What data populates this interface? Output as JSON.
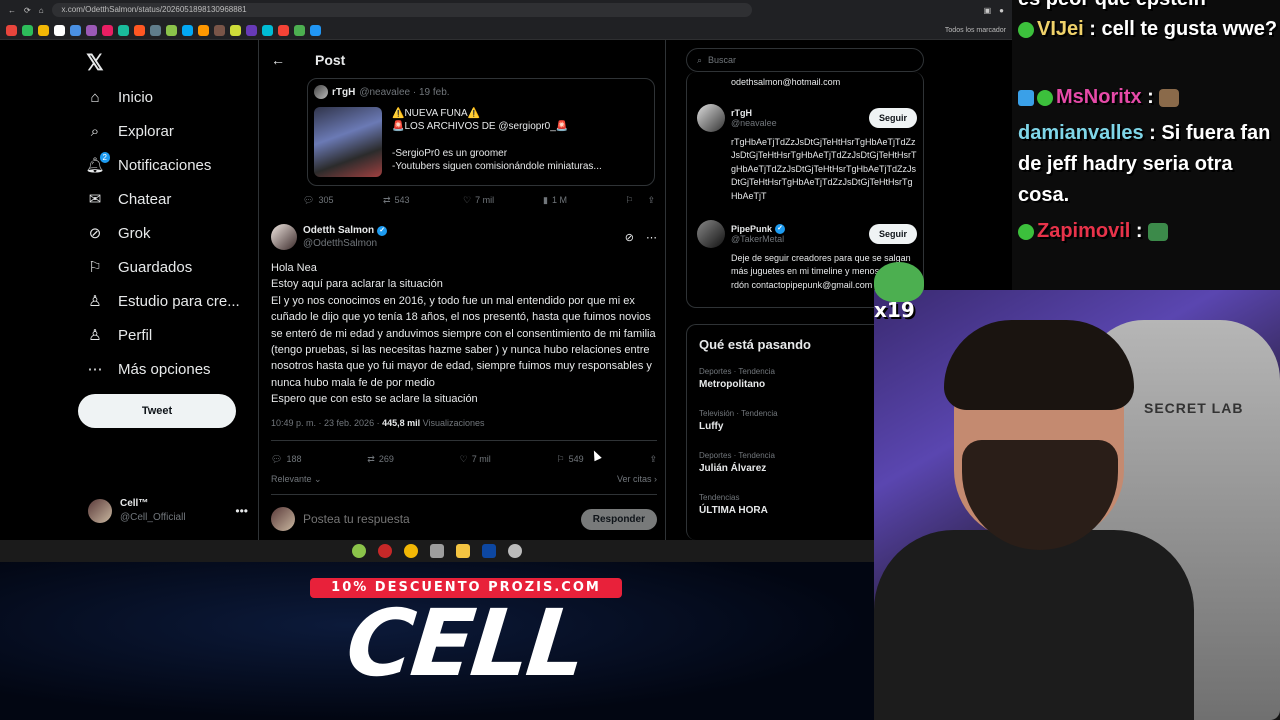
{
  "browser": {
    "url": "x.com/OdetthSalmon/status/2026051898130968881",
    "bookmarks_label": "Todos los marcador"
  },
  "nav": {
    "items": [
      {
        "label": "Inicio",
        "icon": "home-icon"
      },
      {
        "label": "Explorar",
        "icon": "search-icon"
      },
      {
        "label": "Notificaciones",
        "icon": "bell-icon",
        "badge": "2"
      },
      {
        "label": "Chatear",
        "icon": "mail-icon"
      },
      {
        "label": "Grok",
        "icon": "grok-icon"
      },
      {
        "label": "Guardados",
        "icon": "bookmark-icon"
      },
      {
        "label": "Estudio para cre...",
        "icon": "studio-icon"
      },
      {
        "label": "Perfil",
        "icon": "person-icon"
      },
      {
        "label": "Más opciones",
        "icon": "more-circle-icon"
      }
    ],
    "tweet_button": "Tweet",
    "account": {
      "name": "Cell™",
      "handle": "@Cell_Officiall"
    }
  },
  "post": {
    "header_title": "Post",
    "quoted": {
      "name": "rTgH",
      "handle": "@neavalee · 19 feb.",
      "line1": "⚠️NUEVA FUNA⚠️",
      "line2": "🚨LOS ARCHIVOS DE @sergiopr0_🚨",
      "line3": "-SergioPr0 es un groomer",
      "line4": "-Youtubers siguen comisionándole miniaturas..."
    },
    "quoted_stats": {
      "replies": "305",
      "reposts": "543",
      "likes": "7 mil",
      "views": "1 M"
    },
    "author": {
      "name": "Odetth Salmon",
      "handle": "@OdetthSalmon"
    },
    "body": [
      "Hola Nea",
      "Estoy aquí para aclarar la situación",
      "El y yo nos conocimos en 2016, y todo fue un mal entendido por que mi ex cuñado le dijo que yo tenía 18 años, el nos presentó, hasta que fuimos novios se enteró de mi edad y anduvimos siempre con el consentimiento de mi familia (tengo pruebas, si las necesitas hazme saber ) y nunca hubo relaciones entre nosotros hasta que yo fui mayor de edad, siempre fuimos muy responsables y nunca hubo mala fe de por medio",
      "Espero que con esto se aclare la situación"
    ],
    "meta_time": "10:49 p. m. · 23 feb. 2026 · ",
    "meta_views": "445,8 mil",
    "meta_views_label": " Visualizaciones",
    "stats": {
      "replies": "188",
      "reposts": "269",
      "likes": "7 mil",
      "bookmarks": "549"
    },
    "sort_label": "Relevante",
    "quotes_label": "Ver citas",
    "reply_placeholder": "Postea tu respuesta",
    "reply_button": "Responder"
  },
  "sidebar": {
    "search_placeholder": "Buscar",
    "top_email": "odethsalmon@hotmail.com",
    "who": [
      {
        "name": "rTgH",
        "handle": "@neavalee",
        "follow": "Seguir",
        "bio": "rTgHbAeTjTdZzJsDtGjTeHtHsrTgHbAeTjTdZzJsDtGjTeHtHsrTgHbAeTjTdZzJsDtGjTeHtHsrTgHbAeTjTdZzJsDtGjTeHtHsrTgHbAeTjTdZzJsDtGjTeHtHsrTgHbAeTjTdZzJsDtGjTeHtHsrTgHbAeTjT"
      },
      {
        "name": "PipePunk",
        "handle": "@TakerMetal",
        "follow": "Seguir",
        "bio": "Deje de seguir creadores para que se salgan más juguetes en mi timeline y menos spam perdón contactopipepunk@gmail.com"
      }
    ],
    "trends_title": "Qué está pasando",
    "trends": [
      {
        "context": "Deportes · Tendencia",
        "topic": "Metropolitano"
      },
      {
        "context": "Televisión · Tendencia",
        "topic": "Luffy"
      },
      {
        "context": "Deportes · Tendencia",
        "topic": "Julián Álvarez"
      },
      {
        "context": "Tendencias",
        "topic": "ÚLTIMA HORA"
      }
    ]
  },
  "chat": [
    {
      "user": "",
      "text": "es peor que epstein"
    },
    {
      "user": "VIJei",
      "text": " : cell te gusta wwe?",
      "user_color": "#f0d26a"
    },
    {
      "user": "MsNoritx",
      "text": " :",
      "user_color": "#e64aa8"
    },
    {
      "user": "damianvalles",
      "text": " : Si fuera fan de jeff hadry seria otra cosa.",
      "user_color": "#7fd6e8"
    },
    {
      "user": "Zapimovil",
      "text": " :",
      "user_color": "#e8334a"
    }
  ],
  "overlay": {
    "promo": "10% DESCUENTO PROZIS.COM",
    "brand": "CELL",
    "sticker_count": "x19",
    "chair_brand": "SECRET LAB"
  }
}
